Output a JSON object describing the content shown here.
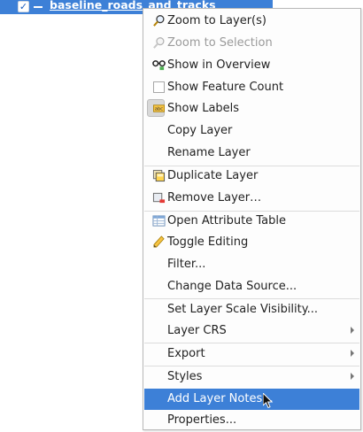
{
  "layer": {
    "checked": true,
    "name": "baseline_roads_and_tracks"
  },
  "menu": {
    "items": [
      {
        "label": "Zoom to Layer(s)",
        "icon": "zoom-layer-icon",
        "disabled": false
      },
      {
        "label": "Zoom to Selection",
        "icon": "zoom-selection-icon",
        "disabled": true
      },
      {
        "label": "Show in Overview",
        "icon": "overview-icon",
        "disabled": false
      },
      {
        "label": "Show Feature Count",
        "icon": "checkbox-icon",
        "disabled": false
      },
      {
        "label": "Show Labels",
        "icon": "labels-icon",
        "disabled": false
      },
      {
        "label": "Copy Layer",
        "icon": "",
        "disabled": false
      },
      {
        "label": "Rename Layer",
        "icon": "",
        "disabled": false
      },
      {
        "label": "Duplicate Layer",
        "icon": "duplicate-layer-icon",
        "disabled": false
      },
      {
        "label": "Remove Layer…",
        "icon": "remove-layer-icon",
        "disabled": false
      },
      {
        "label": "Open Attribute Table",
        "icon": "attribute-table-icon",
        "disabled": false
      },
      {
        "label": "Toggle Editing",
        "icon": "pencil-icon",
        "disabled": false
      },
      {
        "label": "Filter...",
        "icon": "",
        "disabled": false
      },
      {
        "label": "Change Data Source...",
        "icon": "",
        "disabled": false
      },
      {
        "label": "Set Layer Scale Visibility...",
        "icon": "",
        "disabled": false
      },
      {
        "label": "Layer CRS",
        "icon": "",
        "disabled": false,
        "submenu": true
      },
      {
        "label": "Export",
        "icon": "",
        "disabled": false,
        "submenu": true
      },
      {
        "label": "Styles",
        "icon": "",
        "disabled": false,
        "submenu": true
      },
      {
        "label": "Add Layer Notes...",
        "icon": "",
        "disabled": false,
        "highlighted": true
      },
      {
        "label": "Properties...",
        "icon": "",
        "disabled": false
      }
    ]
  },
  "colors": {
    "highlight": "#3d80d7",
    "menu_bg": "#fdfdfd",
    "disabled_text": "#9a9a9a"
  }
}
